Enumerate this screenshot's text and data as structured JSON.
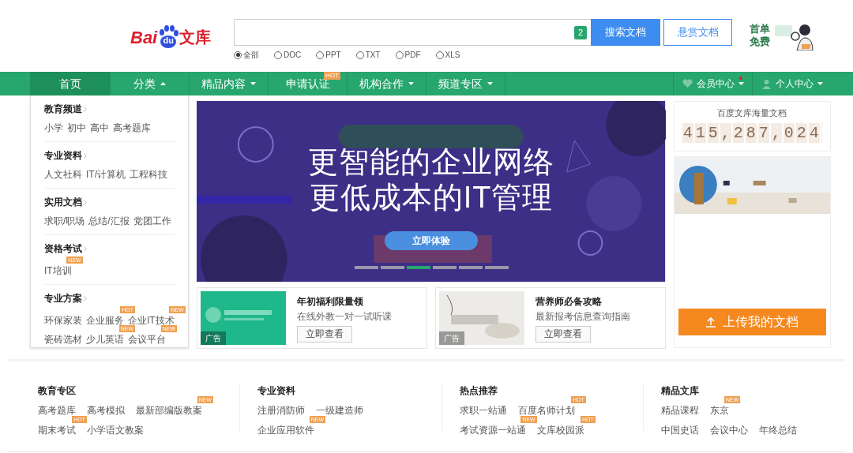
{
  "logo": {
    "prefix": "Bai",
    "paw_text": "du",
    "suffix": "文库"
  },
  "search": {
    "count": "2",
    "button": "搜索文档",
    "reward_button": "悬赏文档"
  },
  "file_types": [
    {
      "label": "全部",
      "selected": true
    },
    {
      "label": "DOC",
      "selected": false
    },
    {
      "label": "PPT",
      "selected": false
    },
    {
      "label": "TXT",
      "selected": false
    },
    {
      "label": "PDF",
      "selected": false
    },
    {
      "label": "XLS",
      "selected": false
    }
  ],
  "promo": {
    "lines": [
      "首单",
      "免费"
    ]
  },
  "nav": [
    {
      "label": "首页",
      "selected": true
    },
    {
      "label": "分类",
      "selected": false,
      "expanded": true
    },
    {
      "label": "精品内容",
      "selected": false,
      "expanded": false
    },
    {
      "label": "申请认证",
      "selected": false,
      "badge": "HOT"
    },
    {
      "label": "机构合作",
      "selected": false,
      "expanded": false
    },
    {
      "label": "频道专区",
      "selected": false,
      "expanded": false
    }
  ],
  "nav_right": [
    {
      "label": "会员中心",
      "kind": "member",
      "dot": true
    },
    {
      "label": "个人中心",
      "kind": "user",
      "dot": false
    }
  ],
  "categories": [
    {
      "title": "教育频道",
      "links": [
        {
          "label": "小学"
        },
        {
          "label": "初中"
        },
        {
          "label": "高中"
        },
        {
          "label": "高考题库"
        }
      ]
    },
    {
      "title": "专业资料",
      "links": [
        {
          "label": "人文社科"
        },
        {
          "label": "IT/计算机"
        },
        {
          "label": "工程科技"
        }
      ]
    },
    {
      "title": "实用文档",
      "links": [
        {
          "label": "求职/职场"
        },
        {
          "label": "总结/汇报"
        },
        {
          "label": "党团工作"
        }
      ]
    },
    {
      "title": "资格考试",
      "links": [
        {
          "label": "IT培训",
          "badge": "NEW"
        }
      ]
    },
    {
      "title": "专业方案",
      "links": [
        {
          "label": "环保家装"
        },
        {
          "label": "企业服务",
          "badge": "HOT"
        },
        {
          "label": "企业IT技术",
          "badge": "NEW"
        },
        {
          "label": "瓷砖选材"
        },
        {
          "label": "少儿英语",
          "badge": "NEW"
        },
        {
          "label": "会议平台",
          "badge": "NEW"
        }
      ]
    }
  ],
  "banner": {
    "lines": [
      "更智能的企业网络",
      "更低成本的IT管理"
    ],
    "button": "立即体验",
    "slides": [
      {
        "selected": false
      },
      {
        "selected": false
      },
      {
        "selected": true
      },
      {
        "selected": false
      },
      {
        "selected": false
      },
      {
        "selected": false
      }
    ]
  },
  "ads": [
    {
      "kind": "green",
      "tag": "广告",
      "title": "年初福利限量领",
      "subtitle": "在线外教一对一试听课",
      "button": "立即查看"
    },
    {
      "kind": "gray",
      "tag": "广告",
      "title": "营养师必备攻略",
      "subtitle": "最新报考信息查询指南",
      "button": "立即查看"
    }
  ],
  "stats": {
    "title": "百度文库海量文档",
    "count": "415,287,024"
  },
  "upload_button": "上传我的文档",
  "footer": [
    {
      "title": "教育专区",
      "rows": [
        [
          {
            "label": "高考题库"
          },
          {
            "label": "高考模拟"
          },
          {
            "label": "最新部编版教案",
            "badge": "NEW"
          }
        ],
        [
          {
            "label": "期末考试",
            "badge": "HOT"
          },
          {
            "label": "小学语文教案"
          }
        ]
      ]
    },
    {
      "title": "专业资料",
      "rows": [
        [
          {
            "label": "注册消防师"
          },
          {
            "label": "一级建造师"
          }
        ],
        [
          {
            "label": "企业应用软件",
            "badge": "NEW"
          }
        ]
      ]
    },
    {
      "title": "热点推荐",
      "rows": [
        [
          {
            "label": "求职一站通"
          },
          {
            "label": "百度名师计划",
            "badge": "HOT"
          }
        ],
        [
          {
            "label": "考试资源一站通",
            "badge": "NEW"
          },
          {
            "label": "文库校园派",
            "badge": "HOT"
          }
        ]
      ]
    },
    {
      "title": "精品文库",
      "rows": [
        [
          {
            "label": "精品课程"
          },
          {
            "label": "东京",
            "badge": "NEW"
          }
        ],
        [
          {
            "label": "中国史话"
          },
          {
            "label": "会议中心"
          },
          {
            "label": "年终总结"
          }
        ]
      ]
    }
  ]
}
